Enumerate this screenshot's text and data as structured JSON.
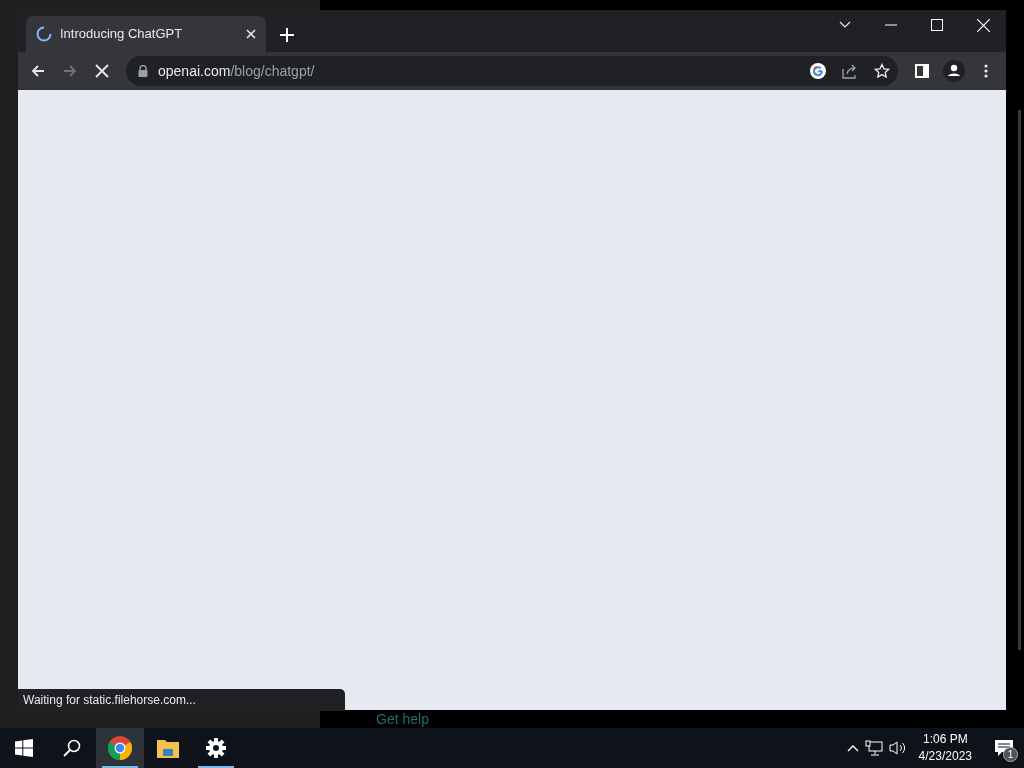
{
  "browser": {
    "tabs": [
      {
        "title": "Introducing ChatGPT",
        "selected": true,
        "loading": true
      }
    ],
    "address": {
      "domain": "openai.com",
      "path": "/blog/chatgpt/"
    },
    "loading": true,
    "status": "Waiting for static.filehorse.com..."
  },
  "background_window": {
    "link": "Get help"
  },
  "taskbar": {
    "apps": [
      {
        "kind": "chrome",
        "selected": true,
        "running": true
      },
      {
        "kind": "files",
        "selected": false,
        "running": false
      },
      {
        "kind": "settings",
        "selected": false,
        "running": true
      }
    ],
    "time": "1:06 PM",
    "date": "4/23/2023",
    "notifications": "1"
  }
}
